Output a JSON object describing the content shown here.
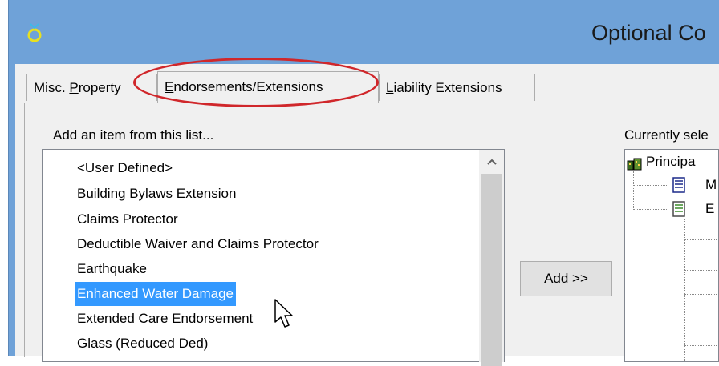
{
  "window": {
    "title": "Optional Co"
  },
  "tabs": [
    {
      "label_pre": "Misc. ",
      "label_key": "P",
      "label_post": "roperty",
      "active": false
    },
    {
      "label_pre": "",
      "label_key": "E",
      "label_post": "ndorsements/Extensions",
      "active": true
    },
    {
      "label_pre": "",
      "label_key": "L",
      "label_post": "iability Extensions",
      "active": false
    }
  ],
  "left_panel": {
    "label": "Add an item from this list...",
    "items": [
      "<User Defined>",
      "Building Bylaws Extension",
      "Claims Protector",
      "Deductible Waiver and Claims Protector",
      "Earthquake",
      "Enhanced Water Damage",
      "Extended Care Endorsement",
      "Glass (Reduced Ded)"
    ],
    "selected_index": 5
  },
  "add_button": {
    "key": "A",
    "rest": "dd >>"
  },
  "right_panel": {
    "label": "Currently sele",
    "tree": [
      {
        "label": "Principa",
        "icon": "buildings-icon"
      },
      {
        "label": "M",
        "icon": "document-blue-icon"
      },
      {
        "label": "E",
        "icon": "document-green-icon"
      }
    ]
  },
  "colors": {
    "titlebar": "#6fa2d8",
    "selection": "#3399ff",
    "highlight_oval": "#d0272b"
  }
}
